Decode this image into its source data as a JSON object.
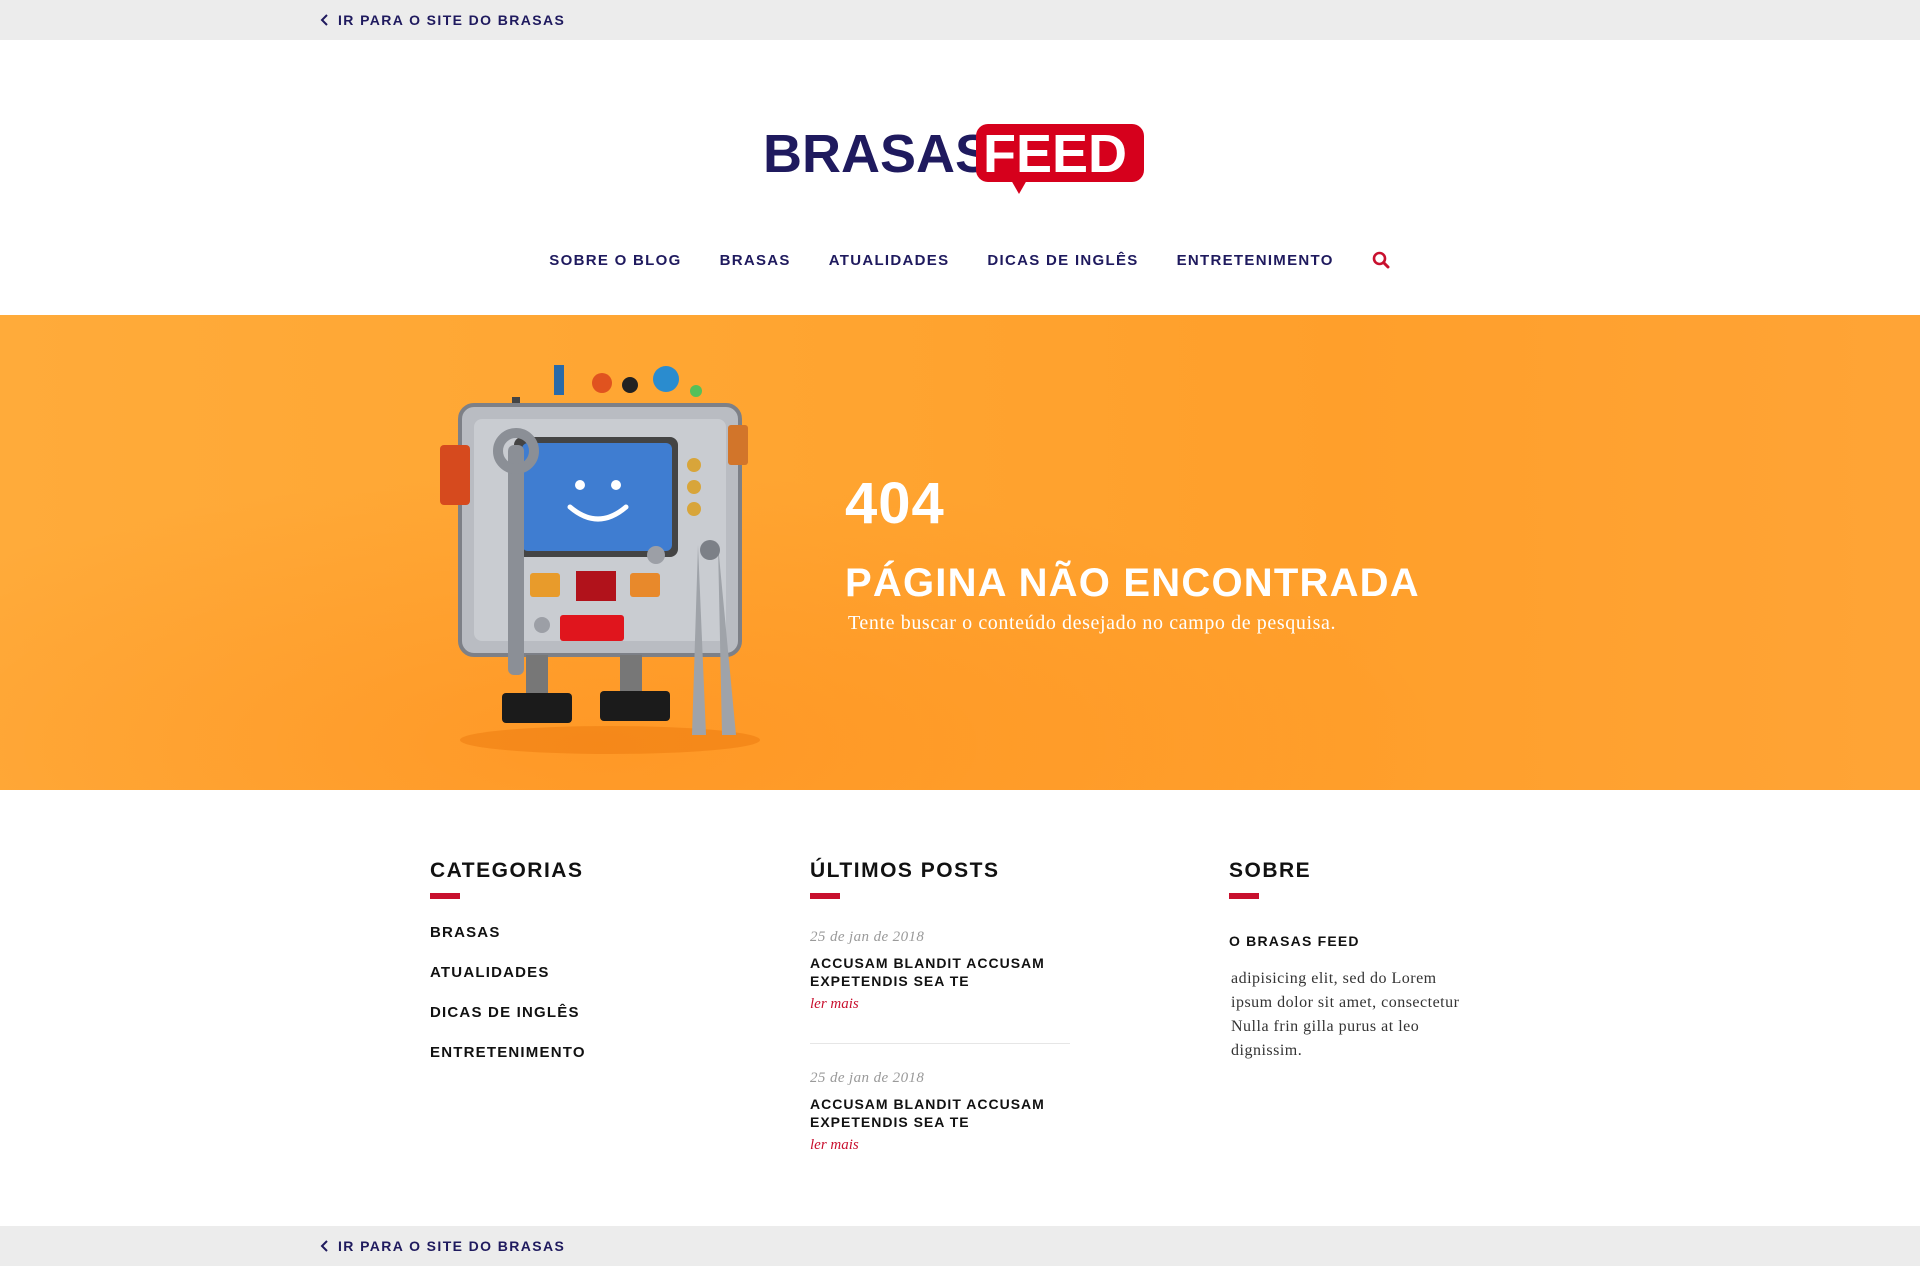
{
  "topbar": {
    "back_label": "IR PARA O SITE DO BRASAS"
  },
  "logo": {
    "part1": "BRASAS",
    "part2": "FEED",
    "color_primary": "#1f1a5e",
    "color_accent": "#d6001c"
  },
  "nav": {
    "items": [
      {
        "label": "SOBRE O BLOG"
      },
      {
        "label": "BRASAS"
      },
      {
        "label": "ATUALIDADES"
      },
      {
        "label": "DICAS DE INGLÊS"
      },
      {
        "label": "ENTRETENIMENTO"
      }
    ],
    "search_icon": "search-icon"
  },
  "hero": {
    "code": "404",
    "title": "PÁGINA NÃO ENCONTRADA",
    "subtitle": "Tente buscar o conteúdo desejado no campo de pesquisa.",
    "background": "#ffa531"
  },
  "footer": {
    "categories": {
      "title": "CATEGORIAS",
      "items": [
        "BRASAS",
        "ATUALIDADES",
        "DICAS DE INGLÊS",
        "ENTRETENIMENTO"
      ]
    },
    "latest_posts": {
      "title": "ÚLTIMOS POSTS",
      "posts": [
        {
          "date": "25 de jan de 2018",
          "title": "ACCUSAM BLANDIT ACCUSAM EXPETENDIS SEA TE",
          "more": "ler mais"
        },
        {
          "date": "25 de jan de 2018",
          "title": "ACCUSAM BLANDIT ACCUSAM EXPETENDIS SEA TE",
          "more": "ler mais"
        }
      ]
    },
    "about": {
      "title": "SOBRE",
      "heading": "O BRASAS FEED",
      "text": "adipisicing elit, sed do Lorem ipsum dolor sit amet, consectetur Nulla frin gilla purus at leo dignissim."
    }
  },
  "bottombar": {
    "back_label": "IR PARA O SITE DO BRASAS"
  },
  "accent_color": "#c8102e"
}
